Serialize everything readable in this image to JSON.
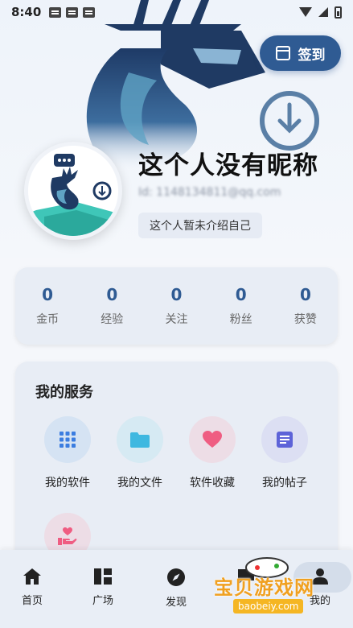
{
  "status_bar": {
    "time": "8:40"
  },
  "header": {
    "signin_label": "签到",
    "nickname": "这个人没有昵称",
    "user_id": "Id: 1148134811@qq.com",
    "bio": "这个人暂未介绍自己"
  },
  "stats": [
    {
      "value": "0",
      "label": "金币"
    },
    {
      "value": "0",
      "label": "经验"
    },
    {
      "value": "0",
      "label": "关注"
    },
    {
      "value": "0",
      "label": "粉丝"
    },
    {
      "value": "0",
      "label": "获赞"
    }
  ],
  "services": {
    "title": "我的服务",
    "items": [
      {
        "label": "我的软件",
        "icon": "grid-icon"
      },
      {
        "label": "我的文件",
        "icon": "folder-icon"
      },
      {
        "label": "软件收藏",
        "icon": "heart-icon"
      },
      {
        "label": "我的帖子",
        "icon": "document-icon"
      },
      {
        "label": "",
        "icon": "hand-heart-icon"
      }
    ]
  },
  "bottom_nav": [
    {
      "label": "首页",
      "icon": "home-icon"
    },
    {
      "label": "广场",
      "icon": "square-grid-icon"
    },
    {
      "label": "发现",
      "icon": "compass-icon"
    },
    {
      "label": "",
      "icon": "chat-icon"
    },
    {
      "label": "我的",
      "icon": "person-icon"
    }
  ],
  "watermark": {
    "text": "宝贝游戏网",
    "url": "baobeiy.com"
  },
  "colors": {
    "accent": "#2f5b93",
    "card": "#e8edf5",
    "teal": "#3fc6b8"
  }
}
